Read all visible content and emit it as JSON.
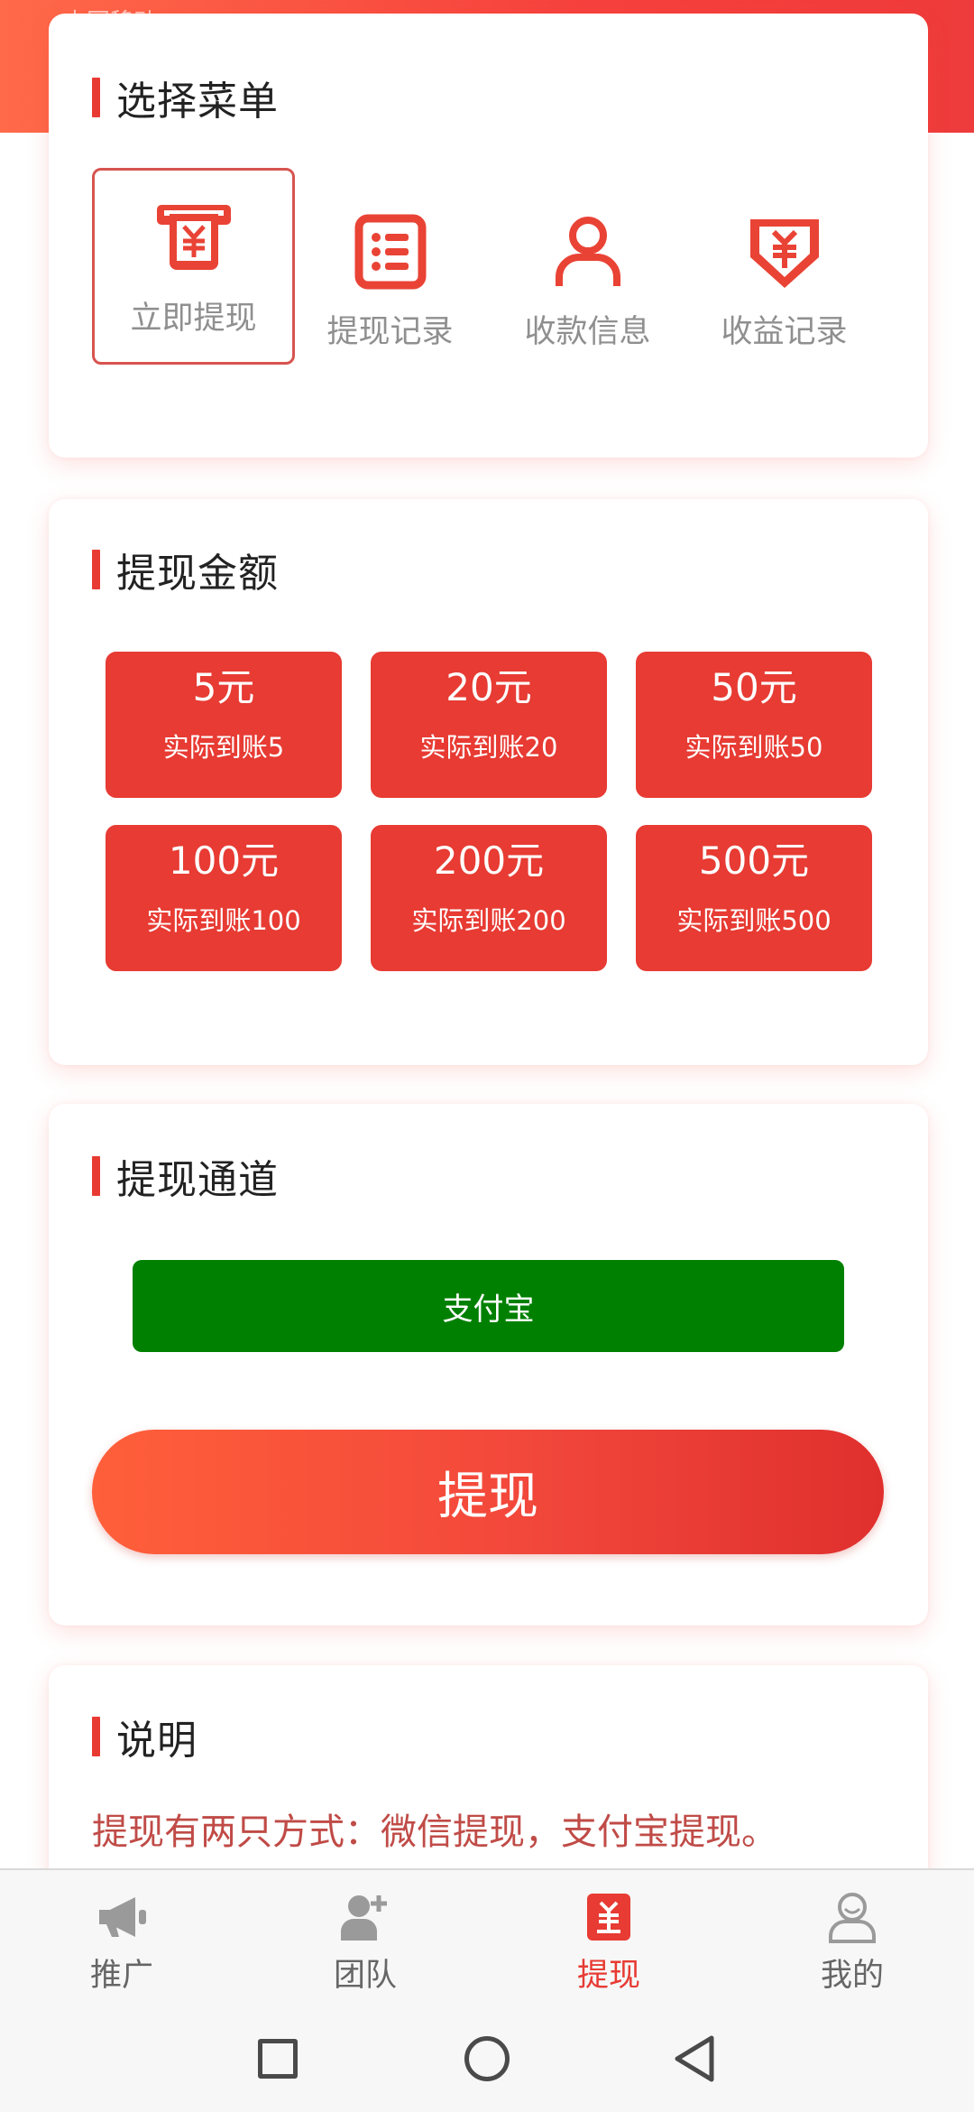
{
  "status_bar": {
    "text": "中国移动"
  },
  "menu_section": {
    "title": "选择菜单",
    "items": [
      {
        "label": "立即提现",
        "icon": "atm-yuan-icon",
        "active": true
      },
      {
        "label": "提现记录",
        "icon": "list-document-icon",
        "active": false
      },
      {
        "label": "收款信息",
        "icon": "user-icon",
        "active": false
      },
      {
        "label": "收益记录",
        "icon": "yuan-shield-icon",
        "active": false
      }
    ]
  },
  "amount_section": {
    "title": "提现金额",
    "options": [
      {
        "amount": "5元",
        "actual": "实际到账5"
      },
      {
        "amount": "20元",
        "actual": "实际到账20"
      },
      {
        "amount": "50元",
        "actual": "实际到账50"
      },
      {
        "amount": "100元",
        "actual": "实际到账100"
      },
      {
        "amount": "200元",
        "actual": "实际到账200"
      },
      {
        "amount": "500元",
        "actual": "实际到账500"
      }
    ]
  },
  "channel_section": {
    "title": "提现通道",
    "channel_label": "支付宝",
    "submit_label": "提现"
  },
  "note_section": {
    "title": "说明",
    "text": "提现有两只方式：微信提现，支付宝提现。"
  },
  "tabbar": {
    "tabs": [
      {
        "label": "推广",
        "icon": "megaphone-icon",
        "active": false
      },
      {
        "label": "团队",
        "icon": "add-user-icon",
        "active": false
      },
      {
        "label": "提现",
        "icon": "withdraw-yuan-icon",
        "active": true
      },
      {
        "label": "我的",
        "icon": "profile-icon",
        "active": false
      }
    ]
  },
  "colors": {
    "accent": "#e73b33",
    "channel_green": "#008000",
    "icon_red": "#e94335",
    "inactive_gray": "#8f8f8f"
  }
}
